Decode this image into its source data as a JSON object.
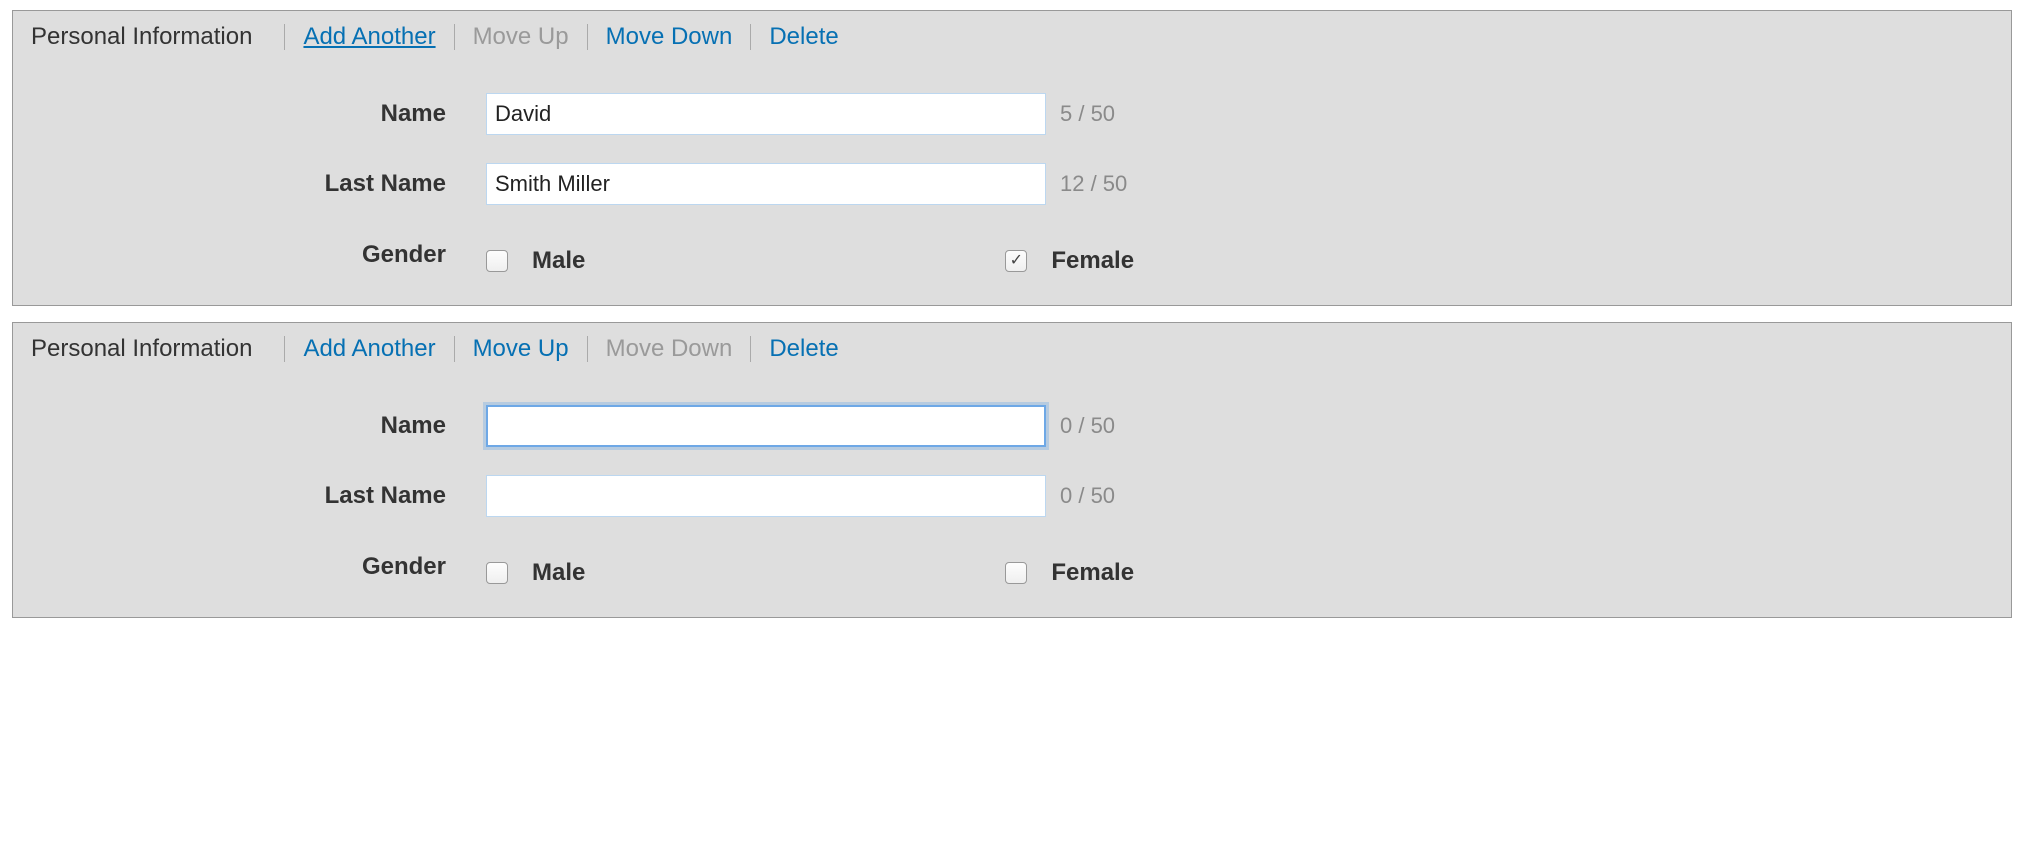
{
  "labels": {
    "panel_title": "Personal Information",
    "add_another": "Add Another",
    "move_up": "Move Up",
    "move_down": "Move Down",
    "delete": "Delete",
    "name": "Name",
    "last_name": "Last Name",
    "gender": "Gender",
    "male": "Male",
    "female": "Female"
  },
  "panels": [
    {
      "add_another_disabled": false,
      "add_another_underline": true,
      "move_up_disabled": true,
      "move_down_disabled": false,
      "delete_disabled": false,
      "name_value": "David",
      "name_counter": "5 / 50",
      "name_focused": false,
      "last_name_value": "Smith Miller",
      "last_name_counter": "12 / 50",
      "male_checked": false,
      "female_checked": true
    },
    {
      "add_another_disabled": false,
      "add_another_underline": false,
      "move_up_disabled": false,
      "move_down_disabled": true,
      "delete_disabled": false,
      "name_value": "",
      "name_counter": "0 / 50",
      "name_focused": true,
      "last_name_value": "",
      "last_name_counter": "0 / 50",
      "male_checked": false,
      "female_checked": false
    }
  ]
}
